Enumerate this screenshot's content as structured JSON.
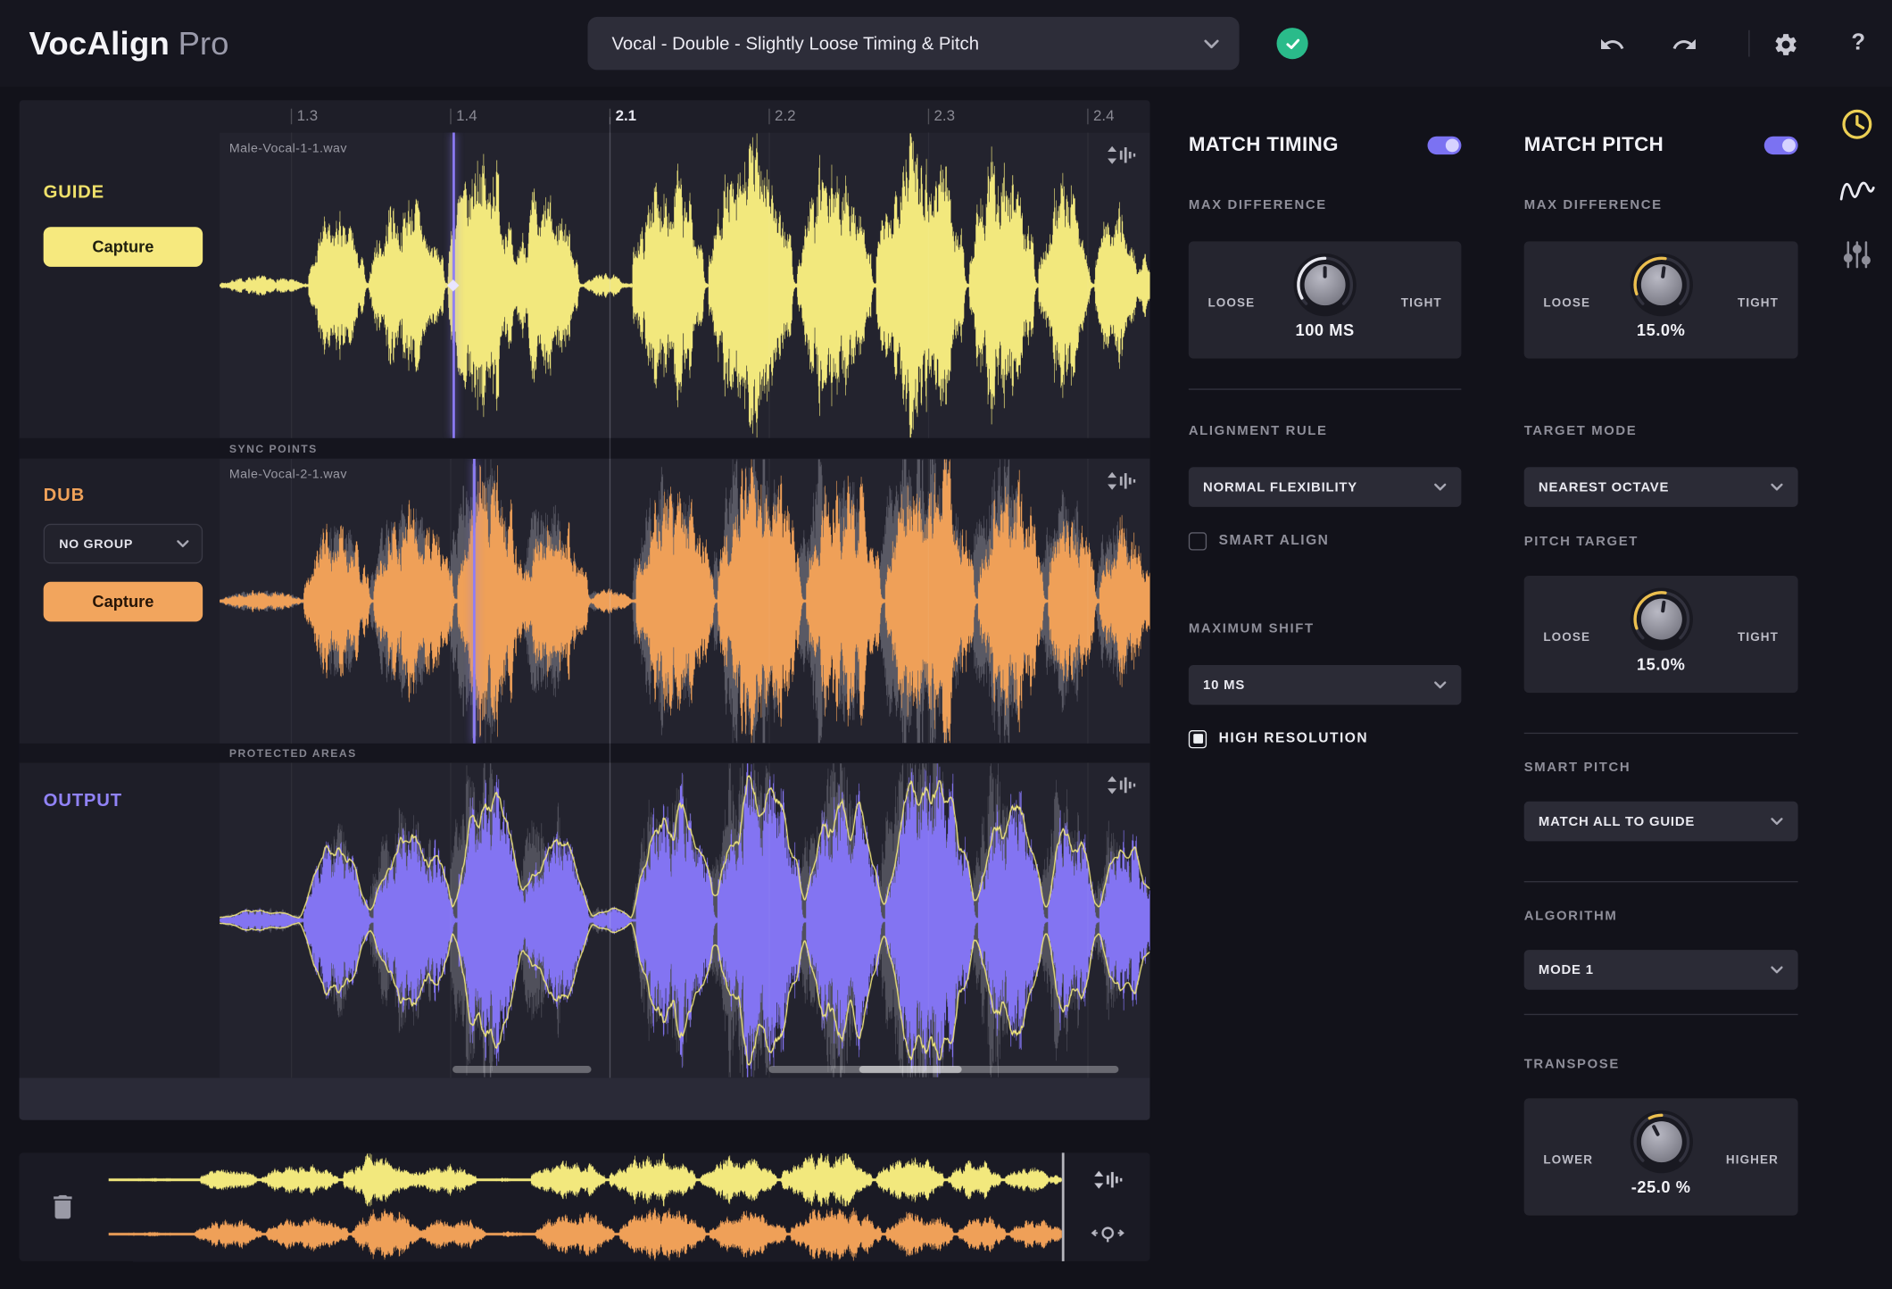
{
  "titlebar": {
    "brand": "VocAlign",
    "brand_suffix": "Pro",
    "preset": "Vocal - Double - Slightly Loose Timing & Pitch",
    "help": "?"
  },
  "timeline": {
    "ticks": [
      "1.3",
      "1.4",
      "2.1",
      "2.2",
      "2.3",
      "2.4"
    ]
  },
  "editor": {
    "guide": {
      "label": "GUIDE",
      "capture": "Capture",
      "file": "Male-Vocal-1-1.wav"
    },
    "sync_points": "SYNC POINTS",
    "dub": {
      "label": "DUB",
      "group": "NO GROUP",
      "capture": "Capture",
      "file": "Male-Vocal-2-1.wav"
    },
    "protected_areas": "PROTECTED AREAS",
    "output": {
      "label": "OUTPUT"
    }
  },
  "timing": {
    "title": "MATCH TIMING",
    "max_difference": {
      "label": "MAX DIFFERENCE",
      "loose": "LOOSE",
      "tight": "TIGHT",
      "value": "100 MS"
    },
    "alignment_rule": {
      "label": "ALIGNMENT RULE",
      "value": "NORMAL FLEXIBILITY"
    },
    "smart_align": "SMART ALIGN",
    "maximum_shift": {
      "label": "MAXIMUM SHIFT",
      "value": "10 MS"
    },
    "high_resolution": "HIGH RESOLUTION"
  },
  "pitch": {
    "title": "MATCH PITCH",
    "max_difference": {
      "label": "MAX DIFFERENCE",
      "loose": "LOOSE",
      "tight": "TIGHT",
      "value": "15.0%"
    },
    "target_mode": {
      "label": "TARGET MODE",
      "value": "NEAREST OCTAVE"
    },
    "pitch_target": {
      "label": "PITCH TARGET",
      "loose": "LOOSE",
      "tight": "TIGHT",
      "value": "15.0%"
    },
    "smart_pitch": {
      "label": "SMART PITCH",
      "value": "MATCH ALL TO GUIDE"
    },
    "algorithm": {
      "label": "ALGORITHM",
      "value": "MODE 1"
    },
    "transpose": {
      "label": "TRANSPOSE",
      "lower": "LOWER",
      "higher": "HIGHER",
      "value": "-25.0 %"
    }
  },
  "colors": {
    "accent_purple": "#7b72f2",
    "guide_yellow": "#f2e87d",
    "dub_orange": "#efa058",
    "output_purple": "#8374f2",
    "success_green": "#2abb8a"
  }
}
